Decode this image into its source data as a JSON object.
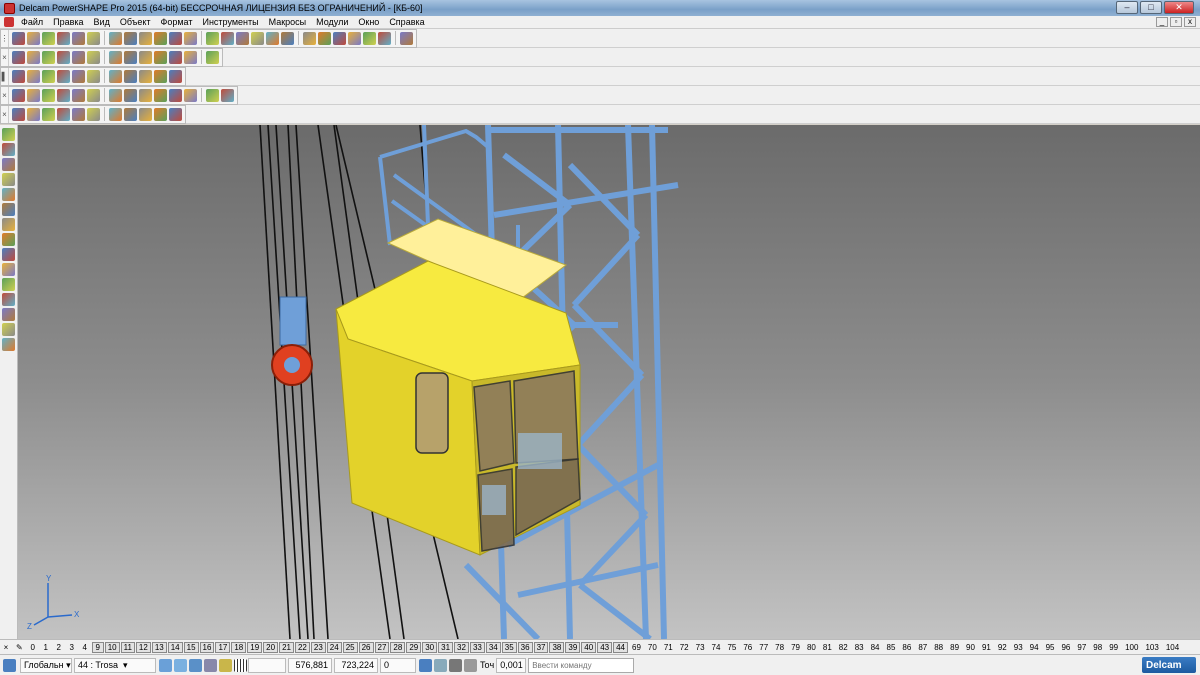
{
  "window": {
    "title": "Delcam PowerSHAPE Pro 2015 (64-bit) БЕССРОЧНАЯ ЛИЦЕНЗИЯ БЕЗ ОГРАНИЧЕНИЙ - [КБ-60]",
    "minimize": "–",
    "maximize": "□",
    "close": "✕"
  },
  "menu": {
    "items": [
      "Файл",
      "Правка",
      "Вид",
      "Объект",
      "Формат",
      "Инструменты",
      "Макросы",
      "Модули",
      "Окно",
      "Справка"
    ]
  },
  "toolbars": {
    "row1_icons": [
      "new-icon",
      "open-icon",
      "save-icon",
      "save-as-icon",
      "print-icon",
      "import-icon",
      "cut-icon",
      "copy-icon",
      "paste-icon",
      "select-icon",
      "delete-icon",
      "undo-icon",
      "redo-icon",
      "text-icon",
      "dimension-icon",
      "line-icon",
      "arc-icon",
      "circle-icon",
      "curve-icon",
      "composite-curve-icon",
      "surface-icon",
      "solid-icon",
      "symbol-icon",
      "wireframe-icon",
      "workplane-icon"
    ],
    "row2_icons": [
      "view-top-icon",
      "view-front-icon",
      "view-iso-icon",
      "zoom-all-icon",
      "zoom-box-icon",
      "pan-icon",
      "zoom-in-icon",
      "zoom-out-icon",
      "rotate-icon",
      "shade-icon",
      "wireframe-view-icon",
      "light-icon",
      "pointer-icon"
    ],
    "row3_icons": [
      "level-icon",
      "material-icon",
      "color-red-icon",
      "color-green-icon",
      "color-yellow-icon",
      "sphere-icon",
      "cone-icon",
      "box-icon",
      "extrude-icon",
      "revolve-icon",
      "sweep-icon"
    ],
    "row4_icons": [
      "fillet-icon",
      "boolean-icon",
      "cut-solid-icon",
      "split-icon",
      "shell-icon",
      "draft-icon",
      "feature-icon",
      "pattern-icon",
      "mirror-icon",
      "offset-icon",
      "thicken-icon",
      "blend-icon",
      "morph-icon",
      "check-icon"
    ],
    "row5_icons": [
      "analyze-icon",
      "measure-icon",
      "smooth-icon",
      "curvature-icon",
      "thickness-icon",
      "section-icon",
      "mesh-icon",
      "export-icon",
      "render-icon",
      "assembly-icon",
      "gear-icon"
    ]
  },
  "layers": {
    "labels": [
      "0",
      "1",
      "2",
      "3",
      "4",
      "9",
      "10",
      "11",
      "12",
      "13",
      "14",
      "15",
      "16",
      "17",
      "18",
      "19",
      "20",
      "21",
      "22",
      "23",
      "24",
      "25",
      "26",
      "27",
      "28",
      "29",
      "30",
      "31",
      "32",
      "33",
      "34",
      "35",
      "36",
      "37",
      "38",
      "39",
      "40",
      "43",
      "44",
      "69",
      "70",
      "71",
      "72",
      "73",
      "74",
      "75",
      "76",
      "77",
      "78",
      "79",
      "80",
      "81",
      "82",
      "83",
      "84",
      "85",
      "86",
      "87",
      "88",
      "89",
      "90",
      "91",
      "92",
      "93",
      "94",
      "95",
      "96",
      "97",
      "98",
      "99",
      "100",
      "103",
      "104"
    ],
    "framed": [
      "9",
      "10",
      "11",
      "12",
      "13",
      "14",
      "15",
      "16",
      "17",
      "18",
      "19",
      "20",
      "21",
      "22",
      "23",
      "24",
      "25",
      "26",
      "27",
      "28",
      "29",
      "30",
      "31",
      "32",
      "33",
      "34",
      "35",
      "36",
      "37",
      "38",
      "39",
      "40",
      "43",
      "44"
    ]
  },
  "status": {
    "workplane": "Глобальн",
    "level": "44 : Trosa",
    "x": "576,881",
    "y": "723,224",
    "z": "0",
    "tol_label": "Toч",
    "tol_value": "0,001",
    "command_placeholder": "Ввести команду",
    "brand": "Delcam"
  },
  "axis": {
    "x": "X",
    "y": "Y",
    "z": "Z"
  },
  "colors": {
    "cabin": "#f5e83a",
    "structure": "#7aa6dc",
    "hook": "#e04020",
    "viewport_top": "#6b6b6b",
    "viewport_bottom": "#c3c3c3"
  }
}
